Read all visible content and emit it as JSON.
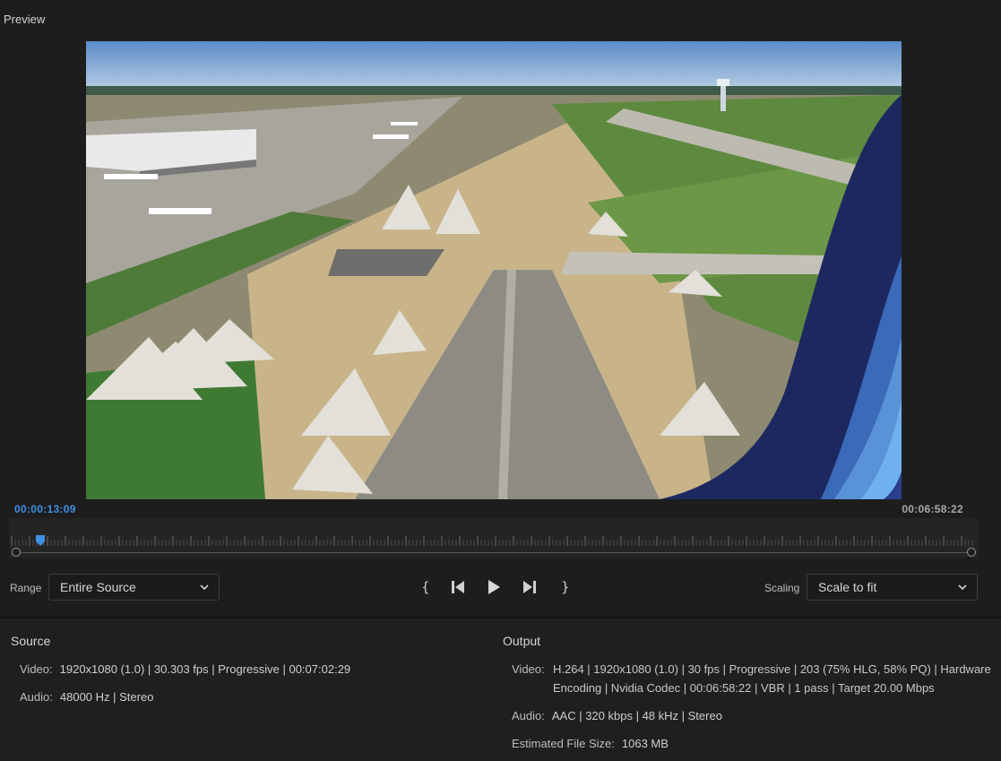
{
  "panel": {
    "title": "Preview"
  },
  "timeline": {
    "current_time": "00:00:13:09",
    "total_time": "00:06:58:22"
  },
  "controls": {
    "range_label": "Range",
    "range_value": "Entire Source",
    "scaling_label": "Scaling",
    "scaling_value": "Scale to fit"
  },
  "source": {
    "title": "Source",
    "video_label": "Video:",
    "video_value": "1920x1080 (1.0) | 30.303 fps | Progressive | 00:07:02:29",
    "audio_label": "Audio:",
    "audio_value": "48000 Hz | Stereo"
  },
  "output": {
    "title": "Output",
    "video_label": "Video:",
    "video_line1": "H.264 | 1920x1080 (1.0) | 30 fps | Progressive | 203 (75% HLG, 58% PQ) | Hardware",
    "video_line2": "Encoding | Nvidia Codec | 00:06:58:22 | VBR | 1 pass | Target 20.00 Mbps",
    "audio_label": "Audio:",
    "audio_value": "AAC | 320 kbps | 48 kHz | Stereo",
    "filesize_label": "Estimated File Size:",
    "filesize_value": "1063 MB"
  },
  "colors": {
    "accent_timecode": "#3f8fe0",
    "background": "#1f1f1f"
  },
  "icons": [
    "mark-in-icon",
    "step-back-icon",
    "play-icon",
    "step-forward-icon",
    "mark-out-icon",
    "chevron-down-icon"
  ]
}
